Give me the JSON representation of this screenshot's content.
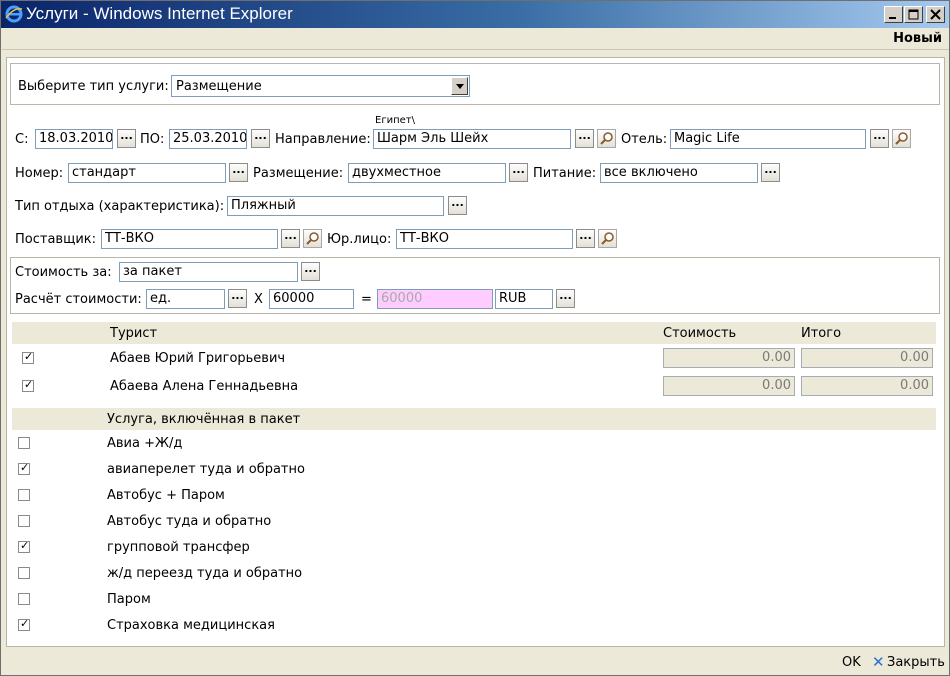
{
  "window": {
    "title": "Услуги - Windows Internet Explorer"
  },
  "header": {
    "new_label": "Новый"
  },
  "service_type": {
    "label": "Выберите тип услуги:",
    "value": "Размещение"
  },
  "dates": {
    "from_label": "С:",
    "from_value": "18.03.2010",
    "to_label": "ПО:",
    "to_value": "25.03.2010"
  },
  "direction": {
    "label": "Направление:",
    "hint": "Египет\\",
    "value": "Шарм Эль Шейх"
  },
  "hotel": {
    "label": "Отель:",
    "value": "Magic Life"
  },
  "room": {
    "label": "Номер:",
    "value": "стандарт"
  },
  "accommodation": {
    "label": "Размещение:",
    "value": "двухместное"
  },
  "meals": {
    "label": "Питание:",
    "value": "все включено"
  },
  "rest_type": {
    "label": "Тип отдыха (характеристика):",
    "value": "Пляжный"
  },
  "supplier": {
    "label": "Поставщик:",
    "value": "ТТ-ВКО"
  },
  "legal_entity": {
    "label": "Юр.лицо:",
    "value": "ТТ-ВКО"
  },
  "cost": {
    "per_label": "Стоимость за:",
    "per_value": "за пакет",
    "calc_label": "Расчёт стоимости:",
    "unit_value": "ед.",
    "times": "X",
    "amount": "60000",
    "equals": "=",
    "total": "60000",
    "currency": "RUB"
  },
  "tourists": {
    "col_tourist": "Турист",
    "col_cost": "Стоимость",
    "col_total": "Итого",
    "rows": [
      {
        "checked": true,
        "name": "Абаев Юрий Григорьевич",
        "cost": "0.00",
        "total": "0.00"
      },
      {
        "checked": true,
        "name": "Абаева Алена Геннадьевна",
        "cost": "0.00",
        "total": "0.00"
      }
    ]
  },
  "package_services": {
    "header": "Услуга, включённая в пакет",
    "items": [
      {
        "checked": false,
        "label": "Авиа +Ж/д"
      },
      {
        "checked": true,
        "label": "авиаперелет туда и обратно"
      },
      {
        "checked": false,
        "label": "Автобус + Паром"
      },
      {
        "checked": false,
        "label": "Автобус туда и обратно"
      },
      {
        "checked": true,
        "label": "групповой трансфер"
      },
      {
        "checked": false,
        "label": "ж/д переезд туда и обратно"
      },
      {
        "checked": false,
        "label": "Паром"
      },
      {
        "checked": true,
        "label": "Страховка медицинская"
      }
    ]
  },
  "footer": {
    "ok_label": "OK",
    "close_label": "Закрыть"
  },
  "buttons": {
    "dots_label": "..."
  },
  "colors": {
    "titlebar": "#0a246a",
    "pink_field": "#ffccff",
    "close_x": "#2a6fd6"
  }
}
